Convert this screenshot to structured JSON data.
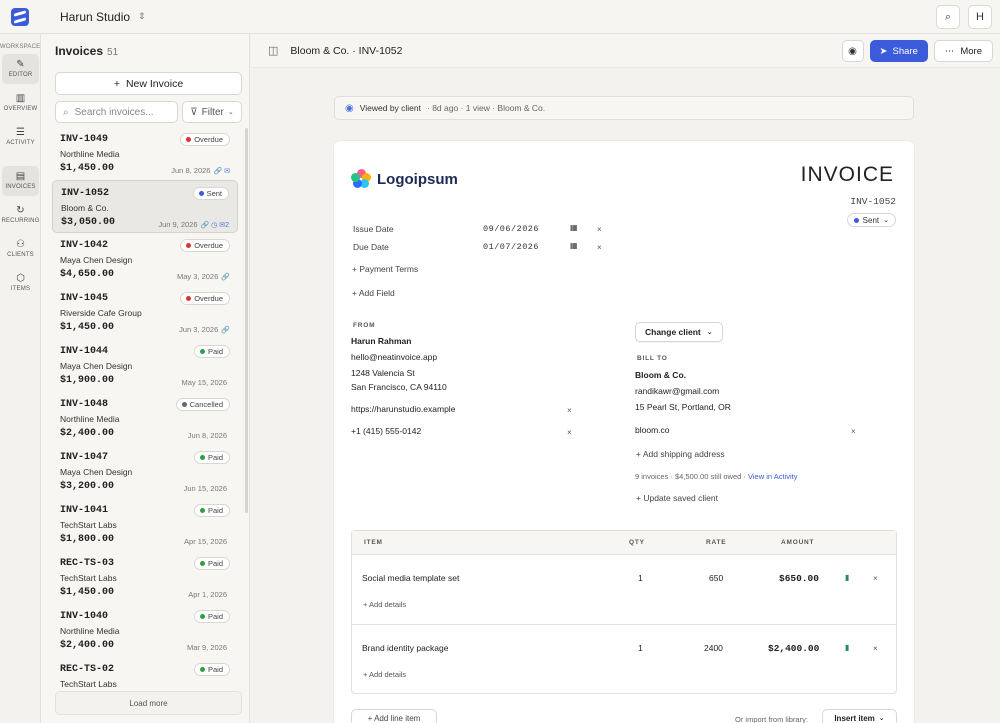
{
  "app": {
    "workspace_name": "Harun Studio",
    "user_initial": "H",
    "icons": {
      "logo": "app-logo-icon",
      "search": "search-icon",
      "switch": "chevron-updown-icon"
    }
  },
  "rail": {
    "section_label": "WORKSPACE",
    "items": [
      {
        "label": "EDITOR",
        "icon": "✎"
      },
      {
        "label": "OVERVIEW",
        "icon": "▥"
      },
      {
        "label": "ACTIVITY",
        "icon": "☰"
      },
      {
        "label": "INVOICES",
        "icon": "▤"
      },
      {
        "label": "RECURRING",
        "icon": "↻"
      },
      {
        "label": "CLIENTS",
        "icon": "⚇"
      },
      {
        "label": "ITEMS",
        "icon": "⬡"
      }
    ]
  },
  "list": {
    "title": "Invoices",
    "count": "51",
    "new_label": "New Invoice",
    "search_placeholder": "Search invoices...",
    "filter_label": "Filter",
    "load_more": "Load more",
    "rows": [
      {
        "id": "INV-1049",
        "client": "Northline Media",
        "amount": "$1,450.00",
        "date": "Jun 8, 2026",
        "status": "Overdue",
        "status_color": "#e03131",
        "icons": "🔗 ✉"
      },
      {
        "id": "INV-1052",
        "client": "Bloom & Co.",
        "amount": "$3,050.00",
        "date": "Jun 9, 2026",
        "status": "Sent",
        "status_color": "#3b5bdb",
        "icons": "🔗 ◷ ✉2"
      },
      {
        "id": "INV-1042",
        "client": "Maya Chen Design",
        "amount": "$4,650.00",
        "date": "May 3, 2026",
        "status": "Overdue",
        "status_color": "#e03131",
        "icons": "🔗"
      },
      {
        "id": "INV-1045",
        "client": "Riverside Cafe Group",
        "amount": "$1,450.00",
        "date": "Jun 3, 2026",
        "status": "Overdue",
        "status_color": "#e03131",
        "icons": "🔗"
      },
      {
        "id": "INV-1044",
        "client": "Maya Chen Design",
        "amount": "$1,900.00",
        "date": "May 15, 2026",
        "status": "Paid",
        "status_color": "#2f9e44",
        "icons": ""
      },
      {
        "id": "INV-1048",
        "client": "Northline Media",
        "amount": "$2,400.00",
        "date": "Jun 8, 2026",
        "status": "Cancelled",
        "status_color": "#666666",
        "icons": ""
      },
      {
        "id": "INV-1047",
        "client": "Maya Chen Design",
        "amount": "$3,200.00",
        "date": "Jun 15, 2026",
        "status": "Paid",
        "status_color": "#2f9e44",
        "icons": ""
      },
      {
        "id": "INV-1041",
        "client": "TechStart Labs",
        "amount": "$1,800.00",
        "date": "Apr 15, 2026",
        "status": "Paid",
        "status_color": "#2f9e44",
        "icons": ""
      },
      {
        "id": "REC-TS-03",
        "client": "TechStart Labs",
        "amount": "$1,450.00",
        "date": "Apr 1, 2026",
        "status": "Paid",
        "status_color": "#2f9e44",
        "icons": ""
      },
      {
        "id": "INV-1040",
        "client": "Northline Media",
        "amount": "$2,400.00",
        "date": "Mar 9, 2026",
        "status": "Paid",
        "status_color": "#2f9e44",
        "icons": ""
      },
      {
        "id": "REC-TS-02",
        "client": "TechStart Labs",
        "amount": "",
        "date": "",
        "status": "Paid",
        "status_color": "#2f9e44",
        "icons": ""
      }
    ]
  },
  "main": {
    "breadcrumb": "Bloom & Co. · INV-1052",
    "share_label": "Share",
    "more_label": "More",
    "viewed": {
      "strong": "Viewed by client",
      "rest": "· 8d ago · 1 view · Bloom & Co."
    }
  },
  "invoice": {
    "logo_text": "Logoipsum",
    "title": "INVOICE",
    "number": "INV-1052",
    "status": "Sent",
    "issue_label": "Issue Date",
    "issue_value": "09/06/2026",
    "due_label": "Due Date",
    "due_value": "01/07/2026",
    "payment_terms": "+ Payment Terms",
    "add_field": "+ Add Field",
    "from": {
      "label": "FROM",
      "name": "Harun Rahman",
      "email": "hello@neatinvoice.app",
      "address1": "1248 Valencia St",
      "address2": "San Francisco, CA 94110",
      "website": "https://harunstudio.example",
      "phone": "+1 (415) 555-0142"
    },
    "bill_to": {
      "change_label": "Change client",
      "label": "BILL TO",
      "name": "Bloom & Co.",
      "email": "randikawr@gmail.com",
      "address": "15 Pearl St, Portland, OR",
      "website": "bloom.co",
      "add_shipping": "+ Add shipping address",
      "summary": "9 invoices · $4,500.00 still owed ·",
      "summary_link": "View in Activity",
      "update": "+ Update saved client"
    },
    "table": {
      "headers": {
        "item": "ITEM",
        "qty": "QTY",
        "rate": "RATE",
        "amount": "AMOUNT"
      },
      "rows": [
        {
          "item": "Social media template set",
          "qty": "1",
          "rate": "650",
          "amount": "$650.00",
          "add": "+ Add details"
        },
        {
          "item": "Brand identity package",
          "qty": "1",
          "rate": "2400",
          "amount": "$2,400.00",
          "add": "+ Add details"
        }
      ]
    },
    "add_line": "+ Add line item",
    "import_note": "Or import from library:",
    "insert_label": "Insert item"
  }
}
